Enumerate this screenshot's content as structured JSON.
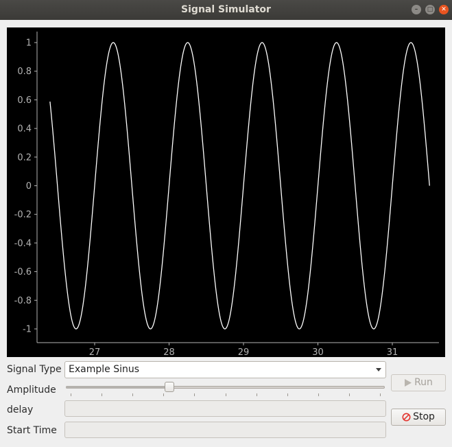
{
  "window": {
    "title": "Signal Simulator",
    "minimize_icon": "minimize-icon",
    "maximize_icon": "maximize-icon",
    "close_icon": "close-icon"
  },
  "plot": {
    "background": "#000000",
    "line_color": "#ffffff",
    "axis_color": "#b4b4b4"
  },
  "chart_data": {
    "type": "line",
    "title": "",
    "xlabel": "",
    "ylabel": "",
    "xlim": [
      26.2,
      31.7
    ],
    "ylim": [
      -1.1,
      1.1
    ],
    "x_ticks": [
      "27",
      "28",
      "29",
      "30",
      "31"
    ],
    "y_ticks": [
      "1",
      "0.8",
      "0.6",
      "0.4",
      "0.2",
      "0",
      "-0.2",
      "-0.4",
      "-0.6",
      "-0.8",
      "-1"
    ],
    "series": [
      {
        "function": "sin(2*pi*x)",
        "x_start": 26.4,
        "x_end": 31.5,
        "amplitude": 1,
        "frequency": 1
      }
    ],
    "grid": false,
    "legend": "none"
  },
  "controls": {
    "signal_type_label": "Signal Type",
    "signal_type_value": "Example Sinus",
    "amplitude_label": "Amplitude",
    "amplitude_value_fraction": 0.32,
    "amplitude_tick_count": 11,
    "delay_label": "delay",
    "delay_value": "",
    "start_time_label": "Start Time",
    "start_time_value": ""
  },
  "buttons": {
    "run_label": "Run",
    "run_enabled": false,
    "run_icon": "play-icon",
    "stop_label": "Stop",
    "stop_icon": "stop-icon",
    "stop_icon_color": "#e3342f"
  }
}
